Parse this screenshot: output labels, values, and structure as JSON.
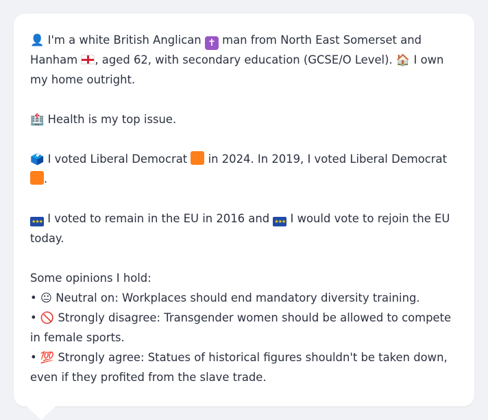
{
  "profile": {
    "intro": {
      "person_icon": "👤",
      "t1": " I'm a white British Anglican ",
      "t2": " man from North East Somerset and Hanham ",
      "t3": ", aged 62, with secondary education (GCSE/O Level). ",
      "house_icon": "🏠",
      "t4": " I own my home outright."
    },
    "health": {
      "hospital_icon": "🏥",
      "text": " Health is my top issue."
    },
    "vote": {
      "ballot_icon": "🗳️",
      "t1": " I voted Liberal Democrat ",
      "t2": " in 2024. In 2019, I voted Liberal Democrat ",
      "t3": ".",
      "party_color": "#ff7f1a"
    },
    "eu": {
      "t1": " I voted to remain in the EU in 2016 and ",
      "t2": " I would vote to rejoin the EU today."
    },
    "opinions": {
      "heading": "Some opinions I hold:",
      "items": [
        {
          "bullet": "•",
          "icon": "😐",
          "text": " Neutral on: Workplaces should end mandatory diversity training."
        },
        {
          "bullet": "•",
          "icon": "🚫",
          "text": " Strongly disagree: Transgender women should be allowed to compete in female sports."
        },
        {
          "bullet": "•",
          "icon": "💯",
          "text": " Strongly agree: Statues of historical figures shouldn't be taken down, even if they profited from the slave trade."
        }
      ]
    }
  },
  "icons": {
    "cross": "✝",
    "eu_stars": "★★★"
  }
}
